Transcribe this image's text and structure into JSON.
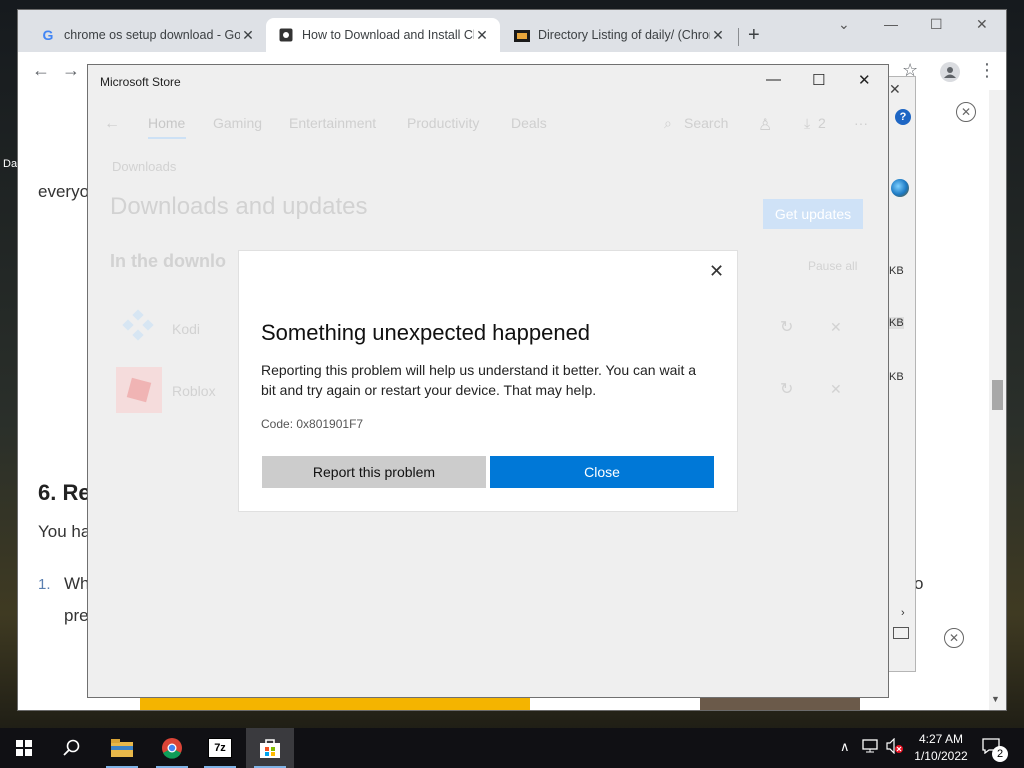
{
  "browser": {
    "tabs": [
      {
        "title": "chrome os setup download - Go",
        "favicon": "google-icon"
      },
      {
        "title": "How to Download and Install Ch",
        "favicon": "site-icon"
      },
      {
        "title": "Directory Listing of daily/ (Chron",
        "favicon": "folder-icon"
      }
    ],
    "new_tab": "+"
  },
  "article": {
    "frag1": "everyo",
    "heading": "6. Re",
    "frag2": "You ha",
    "list_num": "1.",
    "frag3": "Wh",
    "frag4": "pre",
    "frag_right": "o"
  },
  "behind_window": {
    "kb1": "KB",
    "kb2": "KB",
    "kb3": "KB"
  },
  "desktop": {
    "label": "Da"
  },
  "store": {
    "window_title": "Microsoft Store",
    "nav": [
      "Home",
      "Gaming",
      "Entertainment",
      "Productivity",
      "Deals"
    ],
    "search_label": "Search",
    "downloads_count": "2",
    "breadcrumb": "Downloads",
    "page_title": "Downloads and updates",
    "get_updates": "Get updates",
    "section_title": "In the downlo",
    "section_right": "Pause all",
    "apps": [
      {
        "name": "Kodi"
      },
      {
        "name": "Roblox"
      }
    ]
  },
  "dialog": {
    "title": "Something unexpected happened",
    "body": "Reporting this problem will help us understand it better. You can wait a bit and try again or restart your device. That may help.",
    "code": "Code: 0x801901F7",
    "report_label": "Report this problem",
    "close_label": "Close"
  },
  "taskbar": {
    "time": "4:27 AM",
    "date": "1/10/2022",
    "notif_count": "2"
  }
}
